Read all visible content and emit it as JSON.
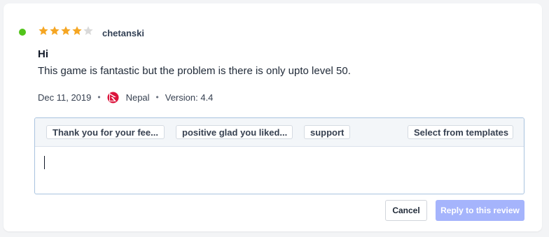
{
  "review": {
    "status_color": "#52c41a",
    "rating": 4,
    "max_rating": 5,
    "star_color": "#f5a623",
    "star_empty_color": "#d9d9d9",
    "reviewer": "chetanski",
    "title": "Hi",
    "body": "This game is fantastic but the problem is there is only upto level 50.",
    "date": "Dec 11, 2019",
    "separator": "•",
    "flag_icon": "nepal-flag-icon",
    "country": "Nepal",
    "version": "Version: 4.4"
  },
  "reply": {
    "templates": [
      {
        "label": "Thank you for your fee..."
      },
      {
        "label": "positive glad you liked..."
      },
      {
        "label": "support"
      }
    ],
    "select_templates_label": "Select from templates",
    "text_value": "",
    "cancel_label": "Cancel",
    "submit_label": "Reply to this review",
    "submit_color": "#a5b4fc"
  }
}
